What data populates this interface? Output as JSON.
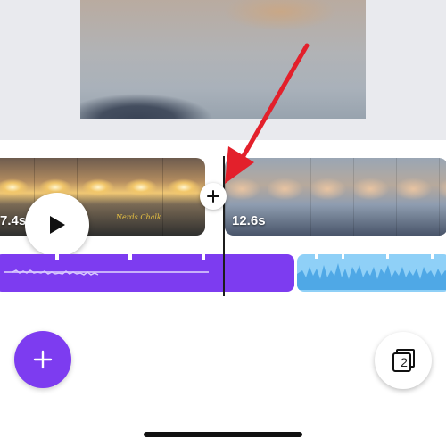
{
  "timeline": {
    "clips": [
      {
        "duration": "7.4s",
        "watermark": "Nerds Chalk"
      },
      {
        "duration": "12.6s"
      }
    ]
  },
  "pages": {
    "count": "2"
  },
  "icons": {
    "play": "play-icon",
    "add_transition": "plus-icon",
    "add": "plus-icon",
    "pages": "pages-stack-icon"
  },
  "colors": {
    "accent": "#7d3cf0",
    "audio_secondary": "#8fd0f7",
    "annotation_arrow": "#e3202b"
  }
}
